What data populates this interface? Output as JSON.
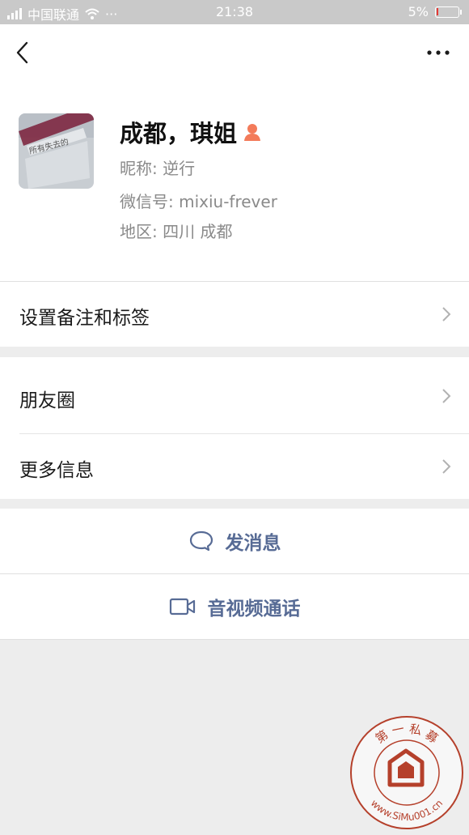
{
  "status_bar": {
    "carrier": "中国联通",
    "dots": "···",
    "time": "21:38",
    "battery_text": "5%",
    "battery_level": 0.05
  },
  "profile": {
    "name": "成都，琪姐",
    "nickname": "昵称: 逆行",
    "wechat_id": "微信号: mixiu-frever",
    "region": "地区: 四川  成都",
    "avatar_caption": "所有失去的"
  },
  "menu": {
    "remark_tags": "设置备注和标签",
    "moments": "朋友圈",
    "more_info": "更多信息"
  },
  "actions": {
    "send_message": "发消息",
    "video_call": "音视频通话"
  },
  "watermark": {
    "top_text": "第 一 私 募",
    "bottom_text": "www.SiMu001.cn"
  },
  "colors": {
    "link_blue": "#576b95",
    "gender_icon": "#f37b5a",
    "battery_low": "#e53935",
    "watermark_red": "#b5402b"
  }
}
